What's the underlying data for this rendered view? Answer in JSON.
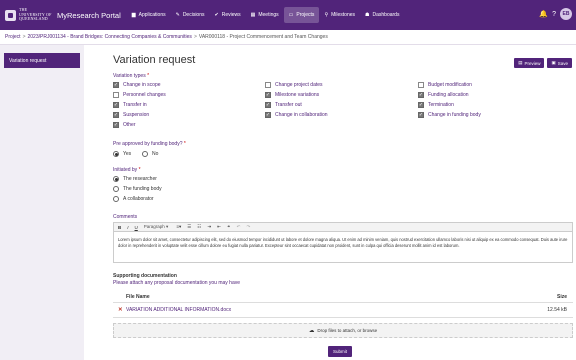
{
  "header": {
    "university": "The University of Queensland",
    "portal": "MyResearch Portal",
    "nav": [
      {
        "icon": "applications-icon",
        "glyph": "▆",
        "label": "Applications"
      },
      {
        "icon": "decisions-icon",
        "glyph": "✎",
        "label": "Decisions"
      },
      {
        "icon": "reviews-icon",
        "glyph": "✔",
        "label": "Reviews"
      },
      {
        "icon": "meetings-icon",
        "glyph": "▦",
        "label": "Meetings"
      },
      {
        "icon": "projects-icon",
        "glyph": "▭",
        "label": "Projects"
      },
      {
        "icon": "milestones-icon",
        "glyph": "⚲",
        "label": "Milestones"
      },
      {
        "icon": "dashboards-icon",
        "glyph": "☗",
        "label": "Dashboards"
      }
    ],
    "bell_glyph": "🔔",
    "help_glyph": "?",
    "avatar_initials": "EB"
  },
  "breadcrumb": {
    "items": [
      "Project",
      "2023/PRJ001134 - Brand Bridges: Connecting Companies & Communities",
      "VAR000118 - Project Commencement and Team Changes"
    ]
  },
  "sidebar": {
    "items": [
      "Variation request"
    ]
  },
  "page": {
    "title": "Variation request",
    "preview_label": "Preview",
    "save_label": "Save"
  },
  "variation_types": {
    "label": "Variation types",
    "options": [
      {
        "label": "Change in scope",
        "checked": true
      },
      {
        "label": "Change project dates",
        "checked": false
      },
      {
        "label": "Budget modification",
        "checked": false
      },
      {
        "label": "Personnel changes",
        "checked": false
      },
      {
        "label": "Milestone variations",
        "checked": true
      },
      {
        "label": "Funding allocation",
        "checked": true
      },
      {
        "label": "Transfer in",
        "checked": true
      },
      {
        "label": "Transfer out",
        "checked": true
      },
      {
        "label": "Termination",
        "checked": true
      },
      {
        "label": "Suspension",
        "checked": true
      },
      {
        "label": "Change in collaboration",
        "checked": true
      },
      {
        "label": "Change in funding body",
        "checked": true
      },
      {
        "label": "Other",
        "checked": true
      }
    ]
  },
  "pre_approved": {
    "label": "Pre approved by funding body?",
    "options": [
      {
        "label": "Yes",
        "selected": true
      },
      {
        "label": "No",
        "selected": false
      }
    ]
  },
  "initiated_by": {
    "label": "Initiated by",
    "options": [
      {
        "label": "The researcher",
        "selected": true
      },
      {
        "label": "The funding body",
        "selected": false
      },
      {
        "label": "A collaborator",
        "selected": false
      }
    ]
  },
  "comments": {
    "label": "Comments",
    "toolbar": {
      "bold": "B",
      "italic": "I",
      "underline": "U",
      "paragraph": "Paragraph",
      "caret": "▾",
      "align": "≡",
      "align_caret": "▾",
      "bullets": "☰",
      "numbers": "☷",
      "indent": "⇥",
      "outdent": "⇤",
      "link": "⚭",
      "undo": "↶",
      "redo": "↷"
    },
    "text": "Lorem ipsum dolor sit amet, consectetur adipiscing elit, sed do eiusmod tempor incididunt ut labore et dolore magna aliqua. Ut enim ad minim veniam, quis nostrud exercitation ullamco laboris nisi ut aliquip ex ea commodo consequat. Duis aute irure dolor in reprehenderit in voluptate velit esse cillum dolore eu fugiat nulla pariatur. Excepteur sint occaecat cupidatat non proident, sunt in culpa qui officia deserunt mollit anim id est laborum."
  },
  "documents": {
    "title": "Supporting documentation",
    "subtitle": "Please attach any proposal documentation you may have",
    "col_name": "File Name",
    "col_size": "Size",
    "files": [
      {
        "name": "VARIATION ADDITIONAL INFORMATION.docx",
        "size": "12.54 kB"
      }
    ],
    "drop_label": "Drop files to attach, or browse",
    "upload_glyph": "☁"
  },
  "submit_label": "Submit"
}
